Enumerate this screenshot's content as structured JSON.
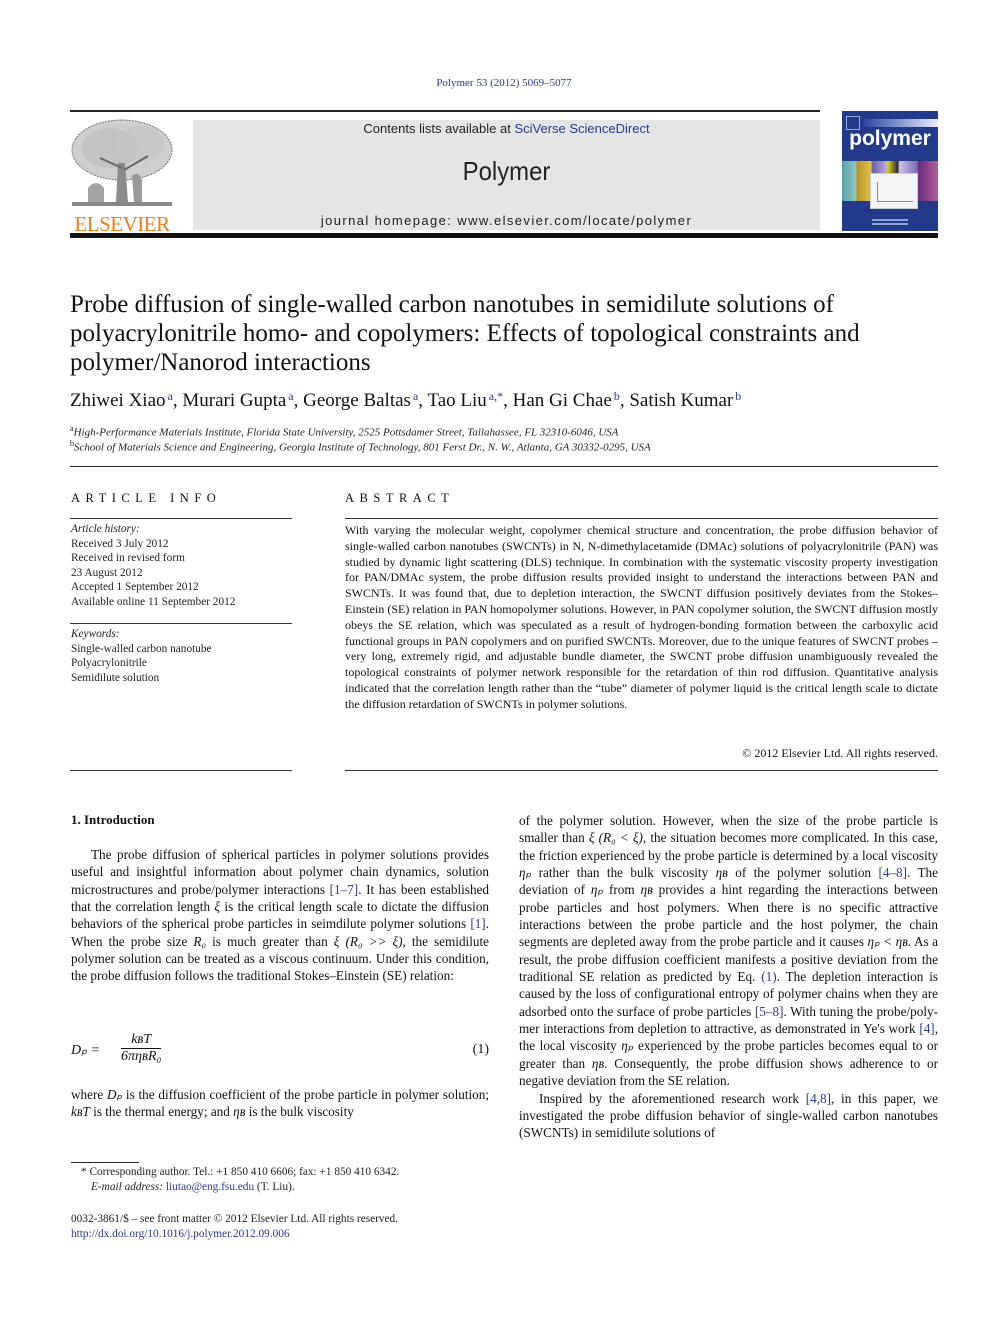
{
  "header": {
    "citation": "Polymer 53 (2012) 5069–5077",
    "contents_prefix": "Contents lists available at ",
    "contents_link": "SciVerse ScienceDirect",
    "journal_name": "Polymer",
    "homepage": "journal homepage: www.elsevier.com/locate/polymer",
    "publisher_logo_text": "ELSEVIER",
    "cover_title": "polymer",
    "colors": {
      "link": "#2a3a8c",
      "elsevier_orange": "#f07c1a",
      "masthead_bg": "#e5e5e5",
      "cover_blue": "#233a8a"
    }
  },
  "article": {
    "title": "Probe diffusion of single-walled carbon nanotubes in semidilute solutions of polyacrylonitrile homo- and copolymers: Effects of topological constraints and polymer/Nanorod interactions",
    "authors": [
      {
        "name": "Zhiwei Xiao",
        "aff": "a"
      },
      {
        "name": "Murari Gupta",
        "aff": "a"
      },
      {
        "name": "George Baltas",
        "aff": "a"
      },
      {
        "name": "Tao Liu",
        "aff": "a,*"
      },
      {
        "name": "Han Gi Chae",
        "aff": "b"
      },
      {
        "name": "Satish Kumar",
        "aff": "b"
      }
    ],
    "affiliations": [
      {
        "key": "a",
        "text": "High-Performance Materials Institute, Florida State University, 2525 Pottsdamer Street, Tallahassee, FL 32310-6046, USA"
      },
      {
        "key": "b",
        "text": "School of Materials Science and Engineering, Georgia Institute of Technology, 801 Ferst Dr., N. W., Atlanta, GA 30332-0295, USA"
      }
    ]
  },
  "article_info": {
    "heading": "ARTICLE INFO",
    "history_label": "Article history:",
    "history": [
      "Received 3 July 2012",
      "Received in revised form",
      "23 August 2012",
      "Accepted 1 September 2012",
      "Available online 11 September 2012"
    ],
    "keywords_label": "Keywords:",
    "keywords": [
      "Single-walled carbon nanotube",
      "Polyacrylonitrile",
      "Semidilute solution"
    ]
  },
  "abstract": {
    "heading": "ABSTRACT",
    "text": "With varying the molecular weight, copolymer chemical structure and concentration, the probe diffusion behavior of single-walled carbon nanotubes (SWCNTs) in N, N-dimethylacetamide (DMAc) solutions of polyacrylonitrile (PAN) was studied by dynamic light scattering (DLS) technique. In combination with the systematic viscosity property investigation for PAN/DMAc system, the probe diffusion results provided insight to understand the interactions between PAN and SWCNTs. It was found that, due to depletion interaction, the SWCNT diffusion positively deviates from the Stokes–Einstein (SE) relation in PAN homopolymer solutions. However, in PAN copolymer solution, the SWCNT diffusion mostly obeys the SE relation, which was speculated as a result of hydrogen-bonding formation between the carboxylic acid functional groups in PAN copolymers and on purified SWCNTs. Moreover, due to the unique features of SWCNT probes – very long, extremely rigid, and adjustable bundle diameter, the SWCNT probe diffusion unambiguously revealed the topological constraints of polymer network responsible for the retardation of thin rod diffusion. Quantitative analysis indicated that the correlation length rather than the “tube” diameter of polymer liquid is the critical length scale to dictate the diffusion retardation of SWCNTs in polymer solutions.",
    "copyright": "© 2012 Elsevier Ltd. All rights reserved."
  },
  "introduction": {
    "heading": "1.  Introduction",
    "p1": [
      {
        "t": "The probe diffusion of spherical particles in polymer solutions provides useful and insightful information about polymer chain dynamics, solution microstructures and probe/polymer interac­tions "
      },
      {
        "ref": "[1–7]"
      },
      {
        "t": ". It has been established that the correlation length "
      },
      {
        "m": "ξ"
      },
      {
        "t": " is the critical length scale to dictate the diffusion behaviors of the spherical probe particles in seimdilute polymer solutions "
      },
      {
        "ref": "[1]"
      },
      {
        "t": ". When the probe size "
      },
      {
        "m": "R₀"
      },
      {
        "t": " is much greater than "
      },
      {
        "m": "ξ (R₀ >> ξ)"
      },
      {
        "t": ", the semidilute polymer solution can be treated as a viscous continuum. Under this condition, the probe diffusion follows the traditional Stokes–Einstein (SE) relation:"
      }
    ],
    "equation": {
      "lhs": "Dₚ =",
      "numerator": "kʙT",
      "denominator": "6πηʙR₀",
      "number": "(1)"
    },
    "p2": [
      {
        "t": "where "
      },
      {
        "m": "Dₚ"
      },
      {
        "t": " is the diffusion coefficient of the probe particle in poly­mer solution; "
      },
      {
        "m": "kʙT"
      },
      {
        "t": " is the thermal energy; and "
      },
      {
        "m": "ηʙ"
      },
      {
        "t": " is the bulk viscosity"
      }
    ],
    "col2_p1": [
      {
        "t": "of the polymer solution. However, when the size of the probe particle is smaller than "
      },
      {
        "m": "ξ (R₀ < ξ)"
      },
      {
        "t": ", the situation becomes more complicated. In this case, the friction experienced by the probe particle is determined by a local viscosity "
      },
      {
        "m": "ηₚ"
      },
      {
        "t": " rather than the bulk viscosity "
      },
      {
        "m": "ηʙ"
      },
      {
        "t": " of the polymer solution "
      },
      {
        "ref": "[4–8]"
      },
      {
        "t": ". The deviation of "
      },
      {
        "m": "ηₚ"
      },
      {
        "t": " from "
      },
      {
        "m": "ηʙ"
      },
      {
        "t": " provides a hint regarding the interactions between probe particles and host polymers. When there is no specific attractive interactions between the probe particle and the host polymer, the chain segments are depleted away from the probe particle and it causes "
      },
      {
        "m": "ηₚ < ηʙ"
      },
      {
        "t": ". As a result, the probe diffusion coefficient manifests a positive deviation from the traditional SE relation as predicted by Eq. "
      },
      {
        "ref": "(1)"
      },
      {
        "t": ". The depletion interaction is caused by the loss of configu­rational entropy of polymer chains when they are adsorbed onto the surface of probe particles "
      },
      {
        "ref": "[5–8]"
      },
      {
        "t": ". With tuning the probe/poly­mer interactions from depletion to attractive, as demonstrated in Ye's work "
      },
      {
        "ref": "[4]"
      },
      {
        "t": ", the local viscosity "
      },
      {
        "m": "ηₚ"
      },
      {
        "t": " experienced by the probe particles becomes equal to or greater than "
      },
      {
        "m": "ηʙ"
      },
      {
        "t": ". Consequently, the probe diffusion shows adherence to or negative deviation from the SE relation."
      }
    ],
    "col2_p2": [
      {
        "t": "Inspired by the aforementioned research work "
      },
      {
        "ref": "[4,8]"
      },
      {
        "t": ", in this paper, we investigated the probe diffusion behavior of single-walled carbon nanotubes (SWCNTs) in semidilute solutions of"
      }
    ]
  },
  "footnotes": {
    "corresponding": "* Corresponding author. Tel.: +1 850 410 6606; fax: +1 850 410 6342.",
    "email_label": "E-mail address: ",
    "email": "liutao@eng.fsu.edu",
    "email_suffix": " (T. Liu).",
    "issn_line": "0032-3861/$ – see front matter © 2012 Elsevier Ltd. All rights reserved.",
    "doi": "http://dx.doi.org/10.1016/j.polymer.2012.09.006"
  }
}
